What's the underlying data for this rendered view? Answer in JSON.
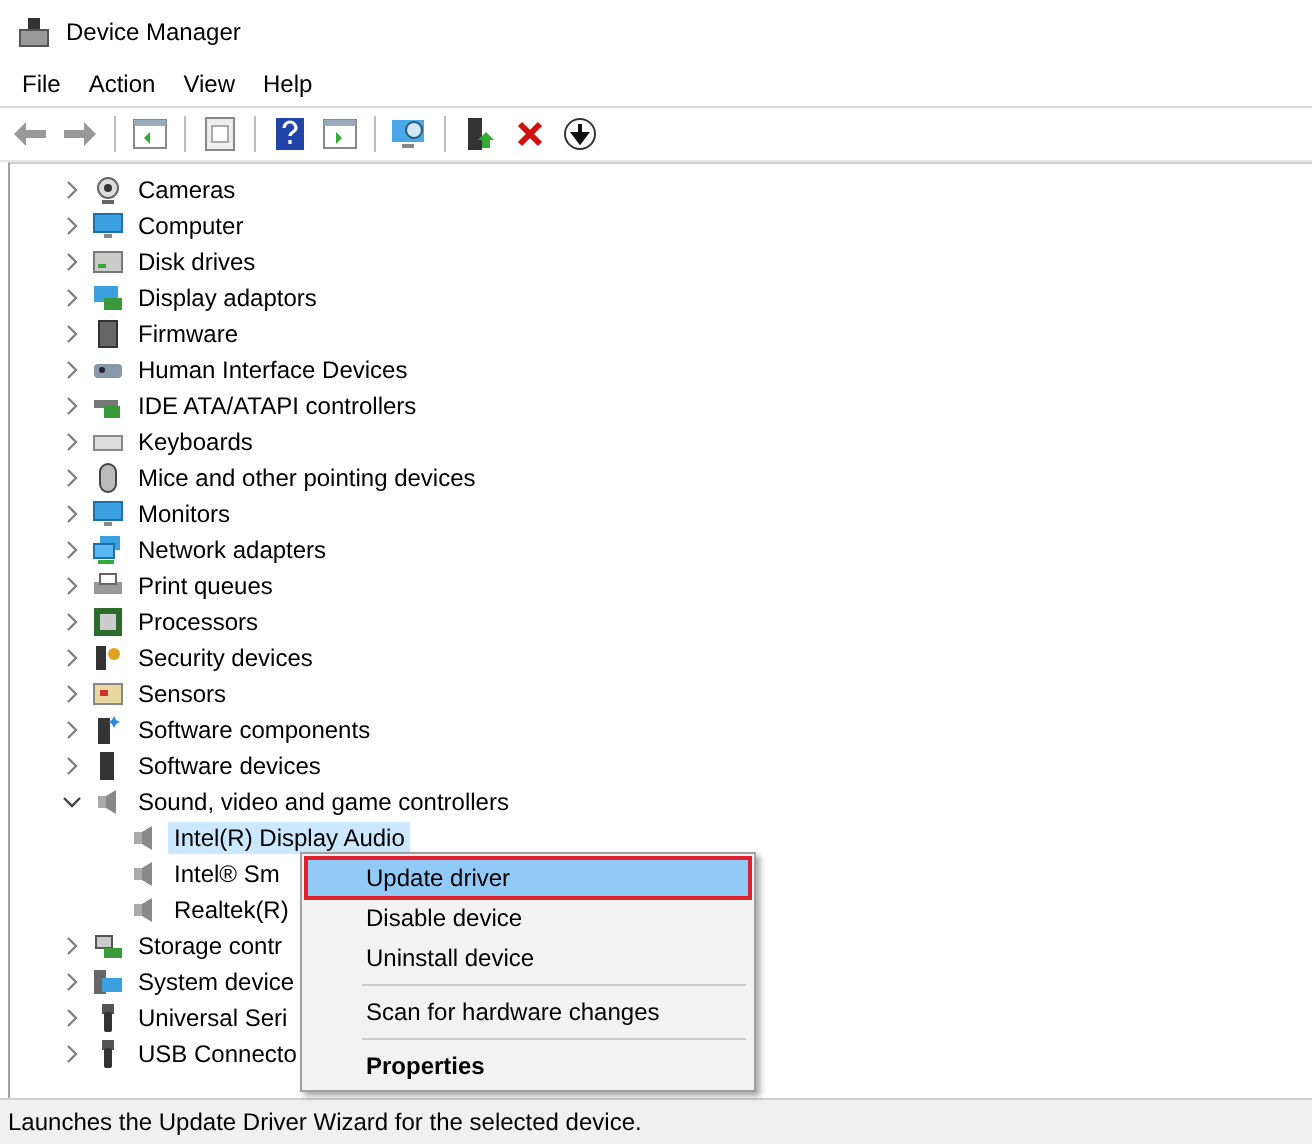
{
  "window": {
    "title": "Device Manager"
  },
  "menu_bar": [
    "File",
    "Action",
    "View",
    "Help"
  ],
  "tree": [
    {
      "label": "Cameras",
      "expanded": false
    },
    {
      "label": "Computer",
      "expanded": false
    },
    {
      "label": "Disk drives",
      "expanded": false
    },
    {
      "label": "Display adaptors",
      "expanded": false
    },
    {
      "label": "Firmware",
      "expanded": false
    },
    {
      "label": "Human Interface Devices",
      "expanded": false
    },
    {
      "label": "IDE ATA/ATAPI controllers",
      "expanded": false
    },
    {
      "label": "Keyboards",
      "expanded": false
    },
    {
      "label": "Mice and other pointing devices",
      "expanded": false
    },
    {
      "label": "Monitors",
      "expanded": false
    },
    {
      "label": "Network adapters",
      "expanded": false
    },
    {
      "label": "Print queues",
      "expanded": false
    },
    {
      "label": "Processors",
      "expanded": false
    },
    {
      "label": "Security devices",
      "expanded": false
    },
    {
      "label": "Sensors",
      "expanded": false
    },
    {
      "label": "Software components",
      "expanded": false
    },
    {
      "label": "Software devices",
      "expanded": false
    },
    {
      "label": "Sound, video and game controllers",
      "expanded": true,
      "children": [
        {
          "label": "Intel(R) Display Audio",
          "selected": true
        },
        {
          "label": "Intel® Sm",
          "selected": false
        },
        {
          "label": "Realtek(R)",
          "selected": false
        }
      ]
    },
    {
      "label": "Storage contr",
      "expanded": false
    },
    {
      "label": "System device",
      "expanded": false
    },
    {
      "label": "Universal Seri",
      "expanded": false
    },
    {
      "label": "USB Connecto",
      "expanded": false
    }
  ],
  "context_menu": [
    {
      "kind": "item",
      "label": "Update driver",
      "selected": true
    },
    {
      "kind": "item",
      "label": "Disable device",
      "selected": false
    },
    {
      "kind": "item",
      "label": "Uninstall device",
      "selected": false
    },
    {
      "kind": "separator"
    },
    {
      "kind": "item",
      "label": "Scan for hardware changes",
      "selected": false
    },
    {
      "kind": "separator"
    },
    {
      "kind": "default",
      "label": "Properties",
      "selected": false
    }
  ],
  "status_bar": "Launches the Update Driver Wizard for the selected device."
}
